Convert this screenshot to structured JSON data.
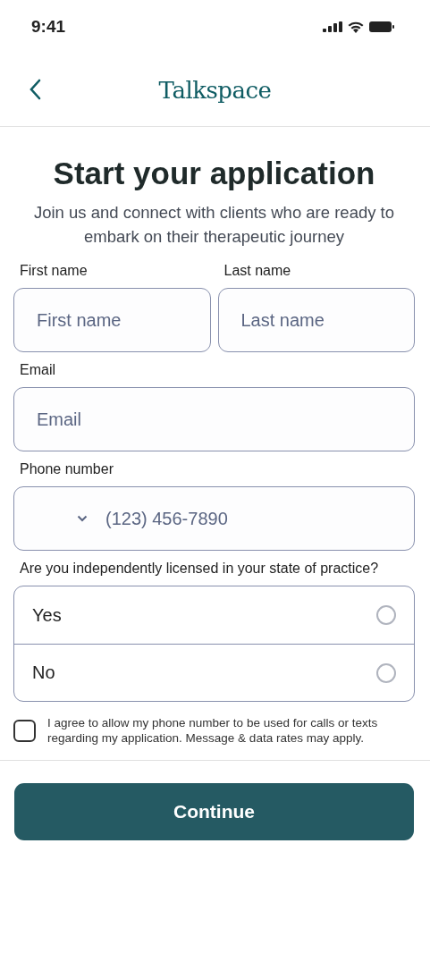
{
  "status_bar": {
    "time": "9:41"
  },
  "header": {
    "brand": "Talkspace"
  },
  "title": "Start your application",
  "subtitle": "Join us and connect with clients who are ready to embark on their therapeutic journey",
  "name_fields": [
    {
      "label": "First name",
      "placeholder": "First name"
    },
    {
      "label": "Last name",
      "placeholder": "Last name"
    }
  ],
  "email": {
    "label": "Email",
    "placeholder": "Email"
  },
  "phone": {
    "label": "Phone number",
    "placeholder": "(123) 456-7890"
  },
  "licensed": {
    "question": "Are you independently licensed in your state of practice?",
    "options": [
      {
        "label": "Yes",
        "selected": false
      },
      {
        "label": "No",
        "selected": false
      }
    ]
  },
  "consent": {
    "text": "I agree to allow my phone number to be used for calls or texts regarding my application. Message & data rates may apply.",
    "checked": false
  },
  "continue_button": "Continue"
}
